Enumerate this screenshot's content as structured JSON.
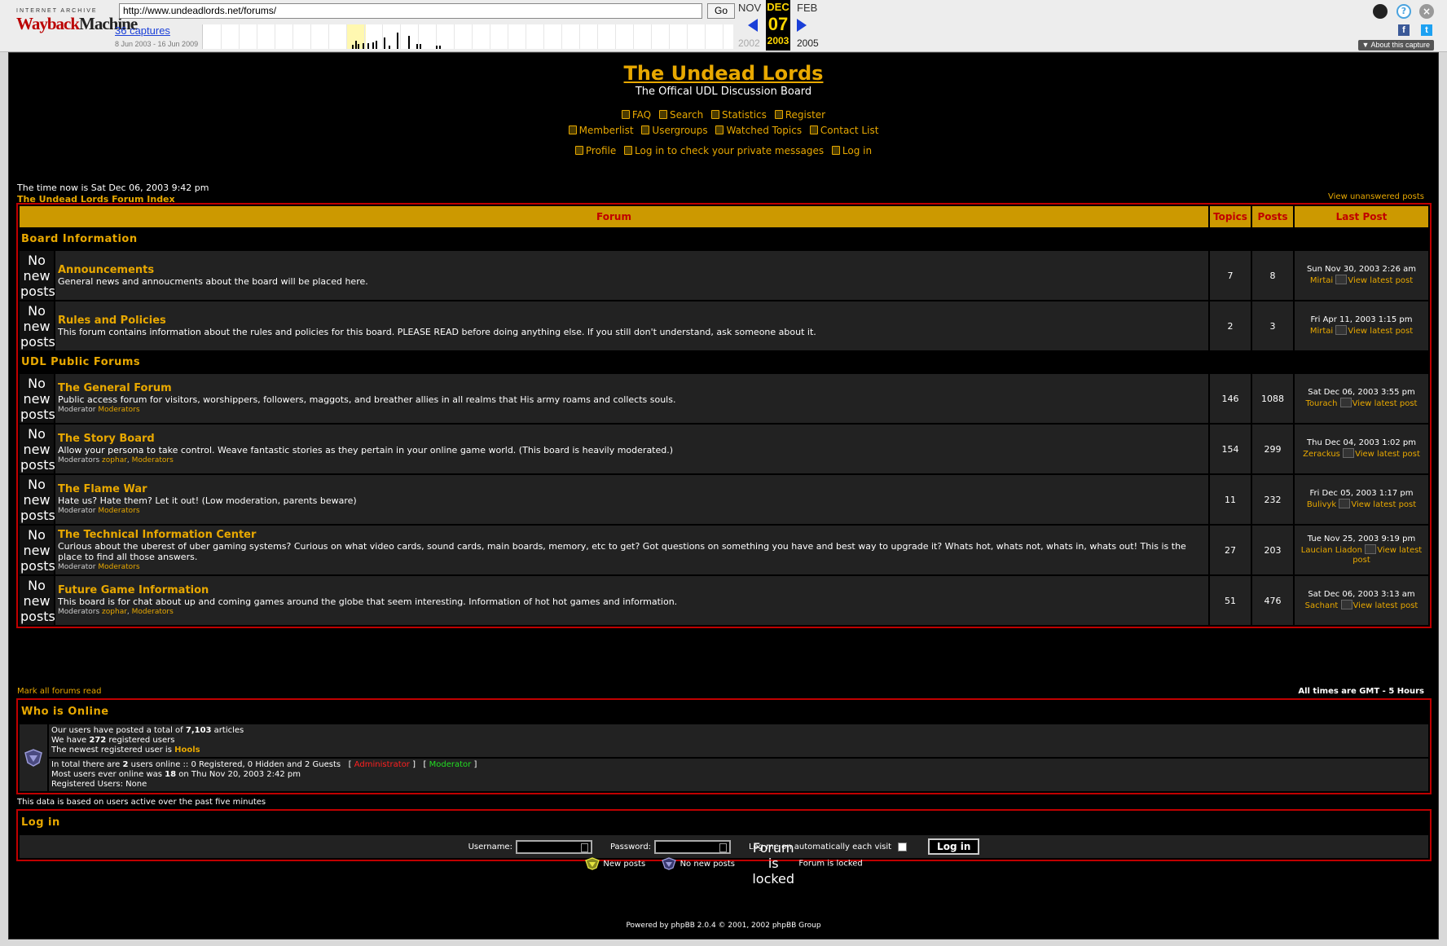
{
  "wayback": {
    "logo_top": "INTERNET ARCHIVE",
    "logo_wayback": "Wayback",
    "logo_machine": "Machine",
    "url": "http://www.undeadlords.net/forums/",
    "go_label": "Go",
    "captures_label": "36 captures",
    "range": "8 Jun 2003 - 16 Jun 2009",
    "prev_month": "NOV",
    "cur_month": "DEC",
    "next_month": "FEB",
    "cur_day": "07",
    "prev_year": "2002",
    "cur_year": "2003",
    "next_year": "2005",
    "about_label": "▼ About this capture"
  },
  "site": {
    "title": "The Undead Lords",
    "subtitle": "The Offical UDL Discussion Board"
  },
  "nav": {
    "faq": "FAQ",
    "search": "Search",
    "statistics": "Statistics",
    "register": "Register",
    "memberlist": "Memberlist",
    "usergroups": "Usergroups",
    "watched": "Watched Topics",
    "contact": "Contact List",
    "profile": "Profile",
    "pm": "Log in to check your private messages",
    "login": "Log in"
  },
  "info": {
    "time_now": "The time now is Sat Dec 06, 2003 9:42 pm",
    "index_link": "The Undead Lords Forum Index",
    "unanswered": "View unanswered posts",
    "mark_read": "Mark all forums read",
    "timezone": "All times are GMT - 5 Hours"
  },
  "table_headers": {
    "forum": "Forum",
    "topics": "Topics",
    "posts": "Posts",
    "last": "Last Post"
  },
  "icon_alt": "No new posts",
  "view_latest": "View latest post",
  "categories": [
    {
      "name": "Board Information",
      "forums": [
        {
          "name": "Announcements",
          "desc": "General news and annoucments about the board will be placed here.",
          "mod_label": "",
          "mods": [],
          "topics": "7",
          "posts": "8",
          "last_date": "Sun Nov 30, 2003 2:26 am",
          "last_user": "Mirtai"
        },
        {
          "name": "Rules and Policies",
          "desc": "This forum contains information about the rules and policies for this board. PLEASE READ before doing anything else. If you still don't understand, ask someone about it.",
          "mod_label": "",
          "mods": [],
          "topics": "2",
          "posts": "3",
          "last_date": "Fri Apr 11, 2003 1:15 pm",
          "last_user": "Mirtai"
        }
      ]
    },
    {
      "name": "UDL Public Forums",
      "forums": [
        {
          "name": "The General Forum",
          "desc": "Public access forum for visitors, worshippers, followers, maggots, and breather allies in all realms that His army roams and collects souls.",
          "mod_label": "Moderator",
          "mods": [
            "Moderators"
          ],
          "topics": "146",
          "posts": "1088",
          "last_date": "Sat Dec 06, 2003 3:55 pm",
          "last_user": "Tourach"
        },
        {
          "name": "The Story Board",
          "desc": "Allow your persona to take control. Weave fantastic stories as they pertain in your online game world. (This board is heavily moderated.)",
          "mod_label": "Moderators",
          "mods": [
            "zophar",
            "Moderators"
          ],
          "topics": "154",
          "posts": "299",
          "last_date": "Thu Dec 04, 2003 1:02 pm",
          "last_user": "Zerackus"
        },
        {
          "name": "The Flame War",
          "desc": "Hate us? Hate them? Let it out! (Low moderation, parents beware)",
          "mod_label": "Moderator",
          "mods": [
            "Moderators"
          ],
          "topics": "11",
          "posts": "232",
          "last_date": "Fri Dec 05, 2003 1:17 pm",
          "last_user": "Bulivyk"
        },
        {
          "name": "The Technical Information Center",
          "desc": "Curious about the uberest of uber gaming systems? Curious on what video cards, sound cards, main boards, memory, etc to get? Got questions on something you have and best way to upgrade it? Whats hot, whats not, whats in, whats out! This is the place to find all those answers.",
          "mod_label": "Moderator",
          "mods": [
            "Moderators"
          ],
          "topics": "27",
          "posts": "203",
          "last_date": "Tue Nov 25, 2003 9:19 pm",
          "last_user": "Laucian Liadon"
        },
        {
          "name": "Future Game Information",
          "desc": "This board is for chat about up and coming games around the globe that seem interesting. Information of hot hot games and information.",
          "mod_label": "Moderators",
          "mods": [
            "zophar",
            "Moderators"
          ],
          "topics": "51",
          "posts": "476",
          "last_date": "Sat Dec 06, 2003 3:13 am",
          "last_user": "Sachant"
        }
      ]
    }
  ],
  "online": {
    "title": "Who is Online",
    "l1_pre": "Our users have posted a total of ",
    "l1_num": "7,103",
    "l1_post": " articles",
    "l2_pre": "We have ",
    "l2_num": "272",
    "l2_post": " registered users",
    "l3_pre": "The newest registered user is ",
    "l3_user": "Hools",
    "l4_pre": "In total there are ",
    "l4_num": "2",
    "l4_post": " users online :: 0 Registered, 0 Hidden and 2 Guests",
    "admin": "Administrator",
    "moderator": "Moderator",
    "l5_pre": "Most users ever online was ",
    "l5_num": "18",
    "l5_post": " on Thu Nov 20, 2003 2:42 pm",
    "l6": "Registered Users: None",
    "based": "This data is based on users active over the past five minutes"
  },
  "login": {
    "title": "Log in",
    "username": "Username:",
    "password": "Password:",
    "auto": "Log me on automatically each visit",
    "button": "Log in"
  },
  "legend": {
    "new": "New posts",
    "nonew": "No new posts",
    "locked_alt": "Forum is locked",
    "locked": "Forum is locked"
  },
  "footer": "Powered by phpBB 2.0.4 © 2001, 2002 phpBB Group"
}
